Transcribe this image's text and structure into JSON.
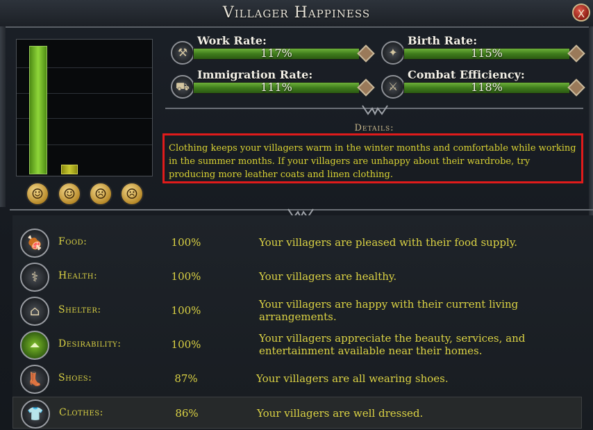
{
  "window": {
    "title": "Villager Happiness",
    "close_label": "X"
  },
  "graph": {
    "masks": [
      "happy-mask-icon",
      "content-mask-icon",
      "neutral-mask-icon",
      "sad-mask-icon"
    ]
  },
  "rates": [
    {
      "label": "Work Rate:",
      "value": "117%",
      "icon": "work-axe-icon"
    },
    {
      "label": "Birth Rate:",
      "value": "115%",
      "icon": "cradle-icon"
    },
    {
      "label": "Immigration Rate:",
      "value": "111%",
      "icon": "wagon-icon"
    },
    {
      "label": "Combat Efficiency:",
      "value": "118%",
      "icon": "sword-icon"
    }
  ],
  "details": {
    "heading": "Details:",
    "text": "Clothing keeps your villagers warm in the winter months and comfortable while working in the summer months. If your villagers are unhappy about their wardrobe, try producing more leather coats and linen clothing."
  },
  "factors": [
    {
      "name": "Food:",
      "percent": "100%",
      "description": "Your villagers are pleased with their food supply.",
      "icon": "meat-icon"
    },
    {
      "name": "Health:",
      "percent": "100%",
      "description": "Your villagers are healthy.",
      "icon": "caduceus-icon"
    },
    {
      "name": "Shelter:",
      "percent": "100%",
      "description": "Your villagers are happy with their current living arrangements.",
      "icon": "house-icon"
    },
    {
      "name": "Desirability:",
      "percent": "100%",
      "description": "Your villagers appreciate the beauty, services, and entertainment available near their homes.",
      "icon": "chevron-up-icon"
    },
    {
      "name": "Shoes:",
      "percent": "87%",
      "description": "Your villagers are all wearing shoes.",
      "icon": "boots-icon"
    },
    {
      "name": "Clothes:",
      "percent": "86%",
      "description": "Your villagers are well dressed.",
      "icon": "tunic-icon"
    }
  ],
  "colors": {
    "accent_text": "#dcd344",
    "highlight_border": "#e01b1b",
    "rate_bar_green": "#4f9128"
  }
}
